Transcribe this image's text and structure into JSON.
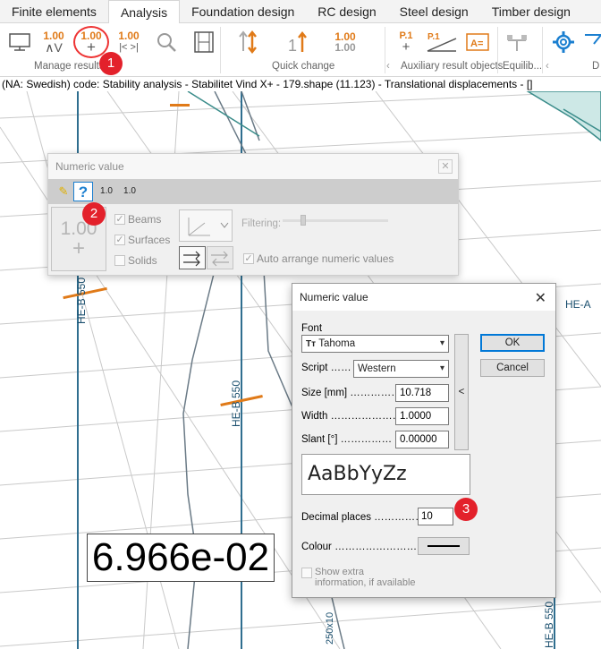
{
  "tabs": [
    "Finite elements",
    "Analysis",
    "Foundation design",
    "RC design",
    "Steel design",
    "Timber design"
  ],
  "active_tab": "Analysis",
  "ribbon": {
    "manage_results_label": "Manage results",
    "quick_change_label": "Quick change",
    "aux_label": "Auxiliary result objects",
    "equilib_label": "Equilib...",
    "d_label": "D",
    "num_icon_text": "1.00",
    "num_icon_sub_arrows": "∧V",
    "num_icon_plus": "+",
    "num_icon_step": "|< >|",
    "p1_text": "P.1",
    "a_eq_text": "A="
  },
  "badges": {
    "one": "1",
    "two": "2",
    "three": "3"
  },
  "status_line": "(NA: Swedish) code: Stability analysis - Stabilitet Vind X+ - 179.shape (11.123) - Translational displacements - []",
  "drawing": {
    "labels": [
      "HE-B 550",
      "HE-B 550",
      "HE-A",
      "HE-B 550",
      "250x10"
    ],
    "big_value": "6.966e-02"
  },
  "numeric_toolbar": {
    "title": "Numeric value",
    "icon_1_0": "1.0",
    "big_btn_top": "1.00",
    "big_btn_bottom": "+",
    "beams": "Beams",
    "surfaces": "Surfaces",
    "solids": "Solids",
    "filtering": "Filtering:",
    "auto_arrange": "Auto arrange numeric values"
  },
  "dialog": {
    "title": "Numeric value",
    "font_label": "Font",
    "font_value": "Tahoma",
    "script_label": "Script ……",
    "script_value": "Western",
    "size_label": "Size [mm] ……………",
    "size_value": "10.718",
    "width_label": "Width …………………",
    "width_value": "1.0000",
    "slant_label": "Slant [°] ……………",
    "slant_value": "0.00000",
    "collapse_arrow": "<",
    "preview": "AaBbYyZz",
    "decimal_label": "Decimal places ……………",
    "decimal_value": "10",
    "colour_label": "Colour ……………………",
    "extra_info": "Show extra information, if available",
    "ok": "OK",
    "cancel": "Cancel"
  },
  "colors": {
    "accent_orange": "#e07a18",
    "badge_red": "#e3212b",
    "structure_teal": "#3a8c8a"
  }
}
